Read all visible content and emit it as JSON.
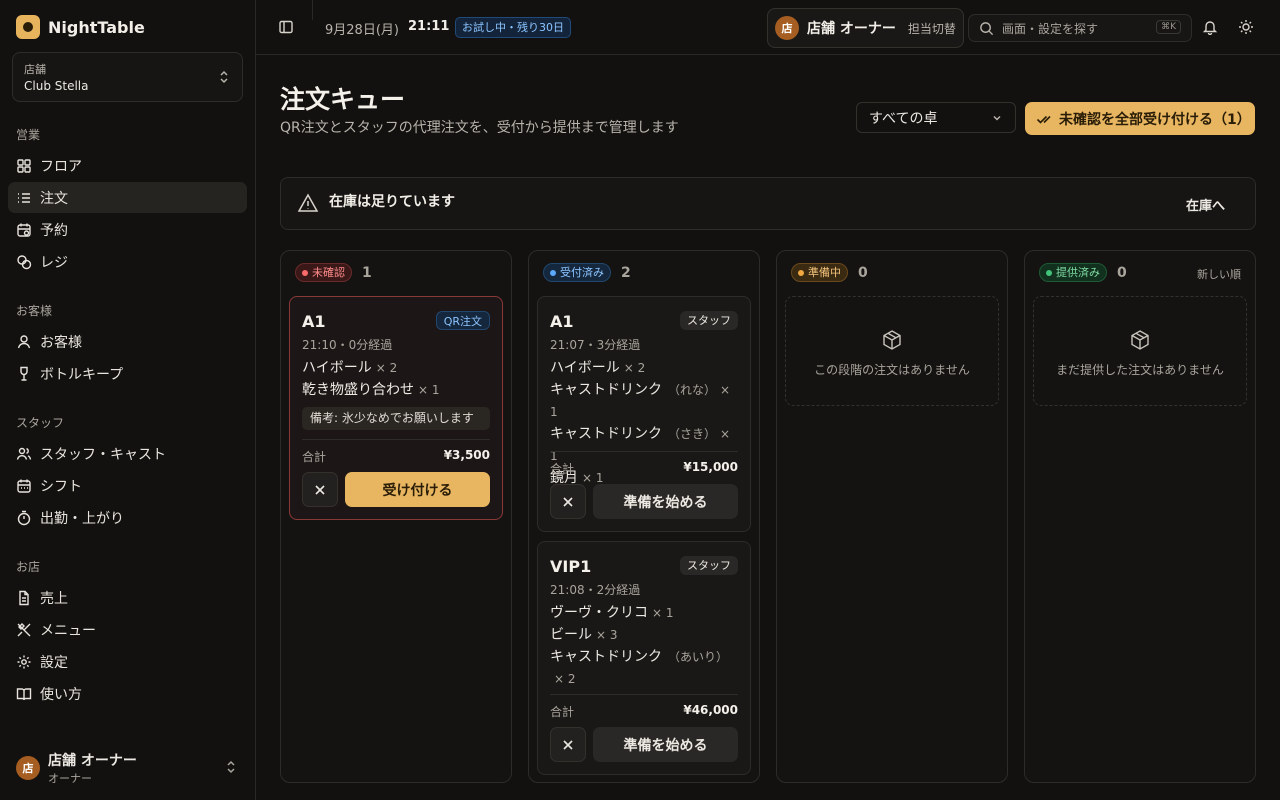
{
  "brand": {
    "name": "NightTable"
  },
  "store": {
    "label": "店舗",
    "name": "Club Stella"
  },
  "sidebar": {
    "sections": [
      {
        "title": "営業",
        "items": [
          "フロア",
          "注文",
          "予約",
          "レジ"
        ]
      },
      {
        "title": "お客様",
        "items": [
          "お客様",
          "ボトルキープ"
        ]
      },
      {
        "title": "スタッフ",
        "items": [
          "スタッフ・キャスト",
          "シフト",
          "出勤・上がり"
        ]
      },
      {
        "title": "お店",
        "items": [
          "売上",
          "メニュー",
          "設定",
          "使い方"
        ]
      }
    ],
    "active_item": "注文"
  },
  "user": {
    "avatar": "店",
    "name": "店舗 オーナー",
    "role": "オーナー"
  },
  "topbar": {
    "date": "9月28日(月)",
    "time": "21:11",
    "trial_badge": "お試し中・残り30日",
    "owner_avatar": "店",
    "owner_name": "店舗 オーナー",
    "owner_switch": "担当切替",
    "search_placeholder": "画面・設定を探す",
    "search_shortcut": "⌘K"
  },
  "page": {
    "title": "注文キュー",
    "subtitle": "QR注文とスタッフの代理注文を、受付から提供まで管理します",
    "table_filter": "すべての卓",
    "accept_all_label": "未確認を全部受け付ける（1）"
  },
  "stock_banner": {
    "text": "在庫は足りています",
    "link": "在庫へ"
  },
  "columns": [
    {
      "status": "未確認",
      "count": "1",
      "color": "#ff6b6b",
      "cards": [
        {
          "table": "A1",
          "tag": "QR注文",
          "time": "21:10・0分経過",
          "items": [
            {
              "name": "ハイボール",
              "cast": "",
              "qty": "× 2"
            },
            {
              "name": "乾き物盛り合わせ",
              "cast": "",
              "qty": "× 1"
            }
          ],
          "note": "備考: 氷少なめでお願いします",
          "total_label": "合計",
          "total": "¥3,500",
          "action": "受け付ける"
        }
      ]
    },
    {
      "status": "受付済み",
      "count": "2",
      "color": "#5aa8ff",
      "cards": [
        {
          "table": "A1",
          "tag": "スタッフ",
          "time": "21:07・3分経過",
          "items": [
            {
              "name": "ハイボール",
              "cast": "",
              "qty": "× 2"
            },
            {
              "name": "キャストドリンク",
              "cast": "（れな）",
              "qty": "× 1"
            },
            {
              "name": "キャストドリンク",
              "cast": "（さき）",
              "qty": "× 1"
            },
            {
              "name": "鏡月",
              "cast": "",
              "qty": "× 1"
            }
          ],
          "total_label": "合計",
          "total": "¥15,000",
          "action": "準備を始める"
        },
        {
          "table": "VIP1",
          "tag": "スタッフ",
          "time": "21:08・2分経過",
          "items": [
            {
              "name": "ヴーヴ・クリコ",
              "cast": "",
              "qty": "× 1"
            },
            {
              "name": "ビール",
              "cast": "",
              "qty": "× 3"
            },
            {
              "name": "キャストドリンク",
              "cast": "（あいり）",
              "qty": "× 2"
            }
          ],
          "total_label": "合計",
          "total": "¥46,000",
          "action": "準備を始める"
        }
      ]
    },
    {
      "status": "準備中",
      "count": "0",
      "color": "#f2a740",
      "empty_text": "この段階の注文はありません"
    },
    {
      "status": "提供済み",
      "count": "0",
      "color": "#41c47a",
      "sort": "新しい順",
      "empty_text": "まだ提供した注文はありません"
    }
  ]
}
